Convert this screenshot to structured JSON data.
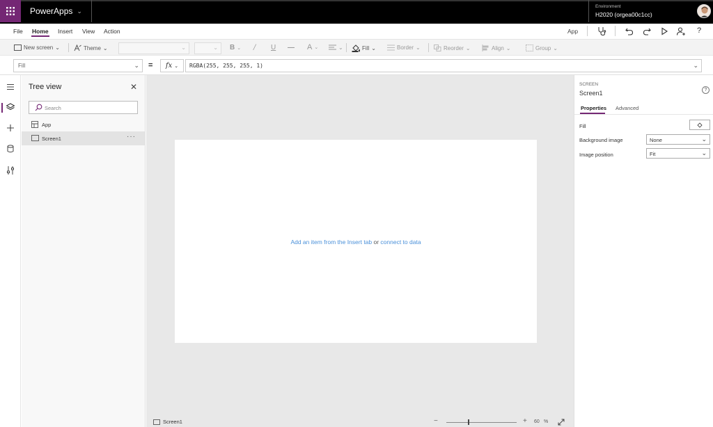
{
  "header": {
    "app_name": "PowerApps",
    "environment_label": "Environment",
    "environment_value": "H2020 (orgea00c1cc)"
  },
  "menu": {
    "items": [
      "File",
      "Home",
      "Insert",
      "View",
      "Action"
    ],
    "active": "Home",
    "app_link": "App"
  },
  "ribbon": {
    "new_screen": "New screen",
    "theme": "Theme",
    "fill": "Fill",
    "border": "Border",
    "reorder": "Reorder",
    "align": "Align",
    "group": "Group"
  },
  "formula": {
    "property": "Fill",
    "fx": "fx",
    "value": "RGBA(255, 255, 255, 1)"
  },
  "tree": {
    "title": "Tree view",
    "search_placeholder": "Search",
    "items": [
      {
        "label": "App",
        "icon": "app-icon",
        "selected": false
      },
      {
        "label": "Screen1",
        "icon": "screen-icon",
        "selected": true,
        "more": "···"
      }
    ]
  },
  "canvas": {
    "hint_link1": "Add an item from the Insert tab",
    "hint_or": " or ",
    "hint_link2": "connect to data"
  },
  "status": {
    "screen_name": "Screen1",
    "zoom_value": "60",
    "zoom_unit": "%",
    "zoom_minus": "−",
    "zoom_plus": "+"
  },
  "properties": {
    "kind": "SCREEN",
    "name": "Screen1",
    "tab_properties": "Properties",
    "tab_advanced": "Advanced",
    "fill_label": "Fill",
    "background_image_label": "Background image",
    "background_image_value": "None",
    "image_position_label": "Image position",
    "image_position_value": "Fit"
  },
  "colors": {
    "brand": "#742774",
    "topbar": "#000000",
    "link": "#4a90d9",
    "canvas_bg": "#e8e8e8"
  }
}
